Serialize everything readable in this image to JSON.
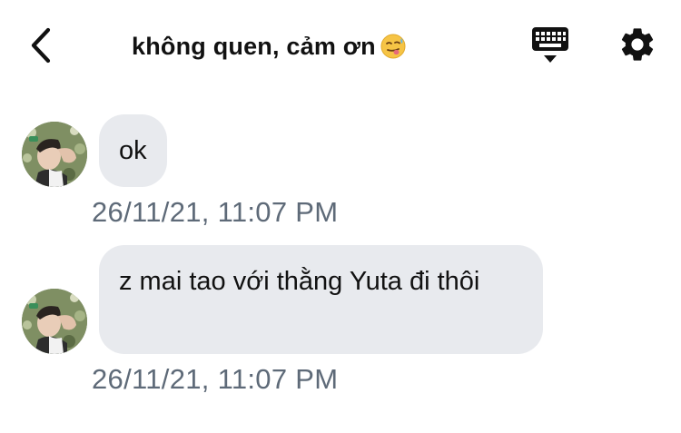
{
  "header": {
    "title": "không quen, cảm ơn",
    "title_emoji": "face-with-tongue-and-sweat-emoji",
    "back_icon": "chevron-left-icon",
    "keyboard_icon": "keyboard-icon",
    "settings_icon": "gear-icon"
  },
  "messages": [
    {
      "text": "ok",
      "timestamp": "26/11/21, 11:07 PM"
    },
    {
      "text": "z mai tao với thằng Yuta đi thôi",
      "timestamp": "26/11/21, 11:07 PM"
    }
  ],
  "colors": {
    "bubble_bg": "#e8eaee",
    "timestamp": "#5e6a78",
    "title": "#111111"
  }
}
